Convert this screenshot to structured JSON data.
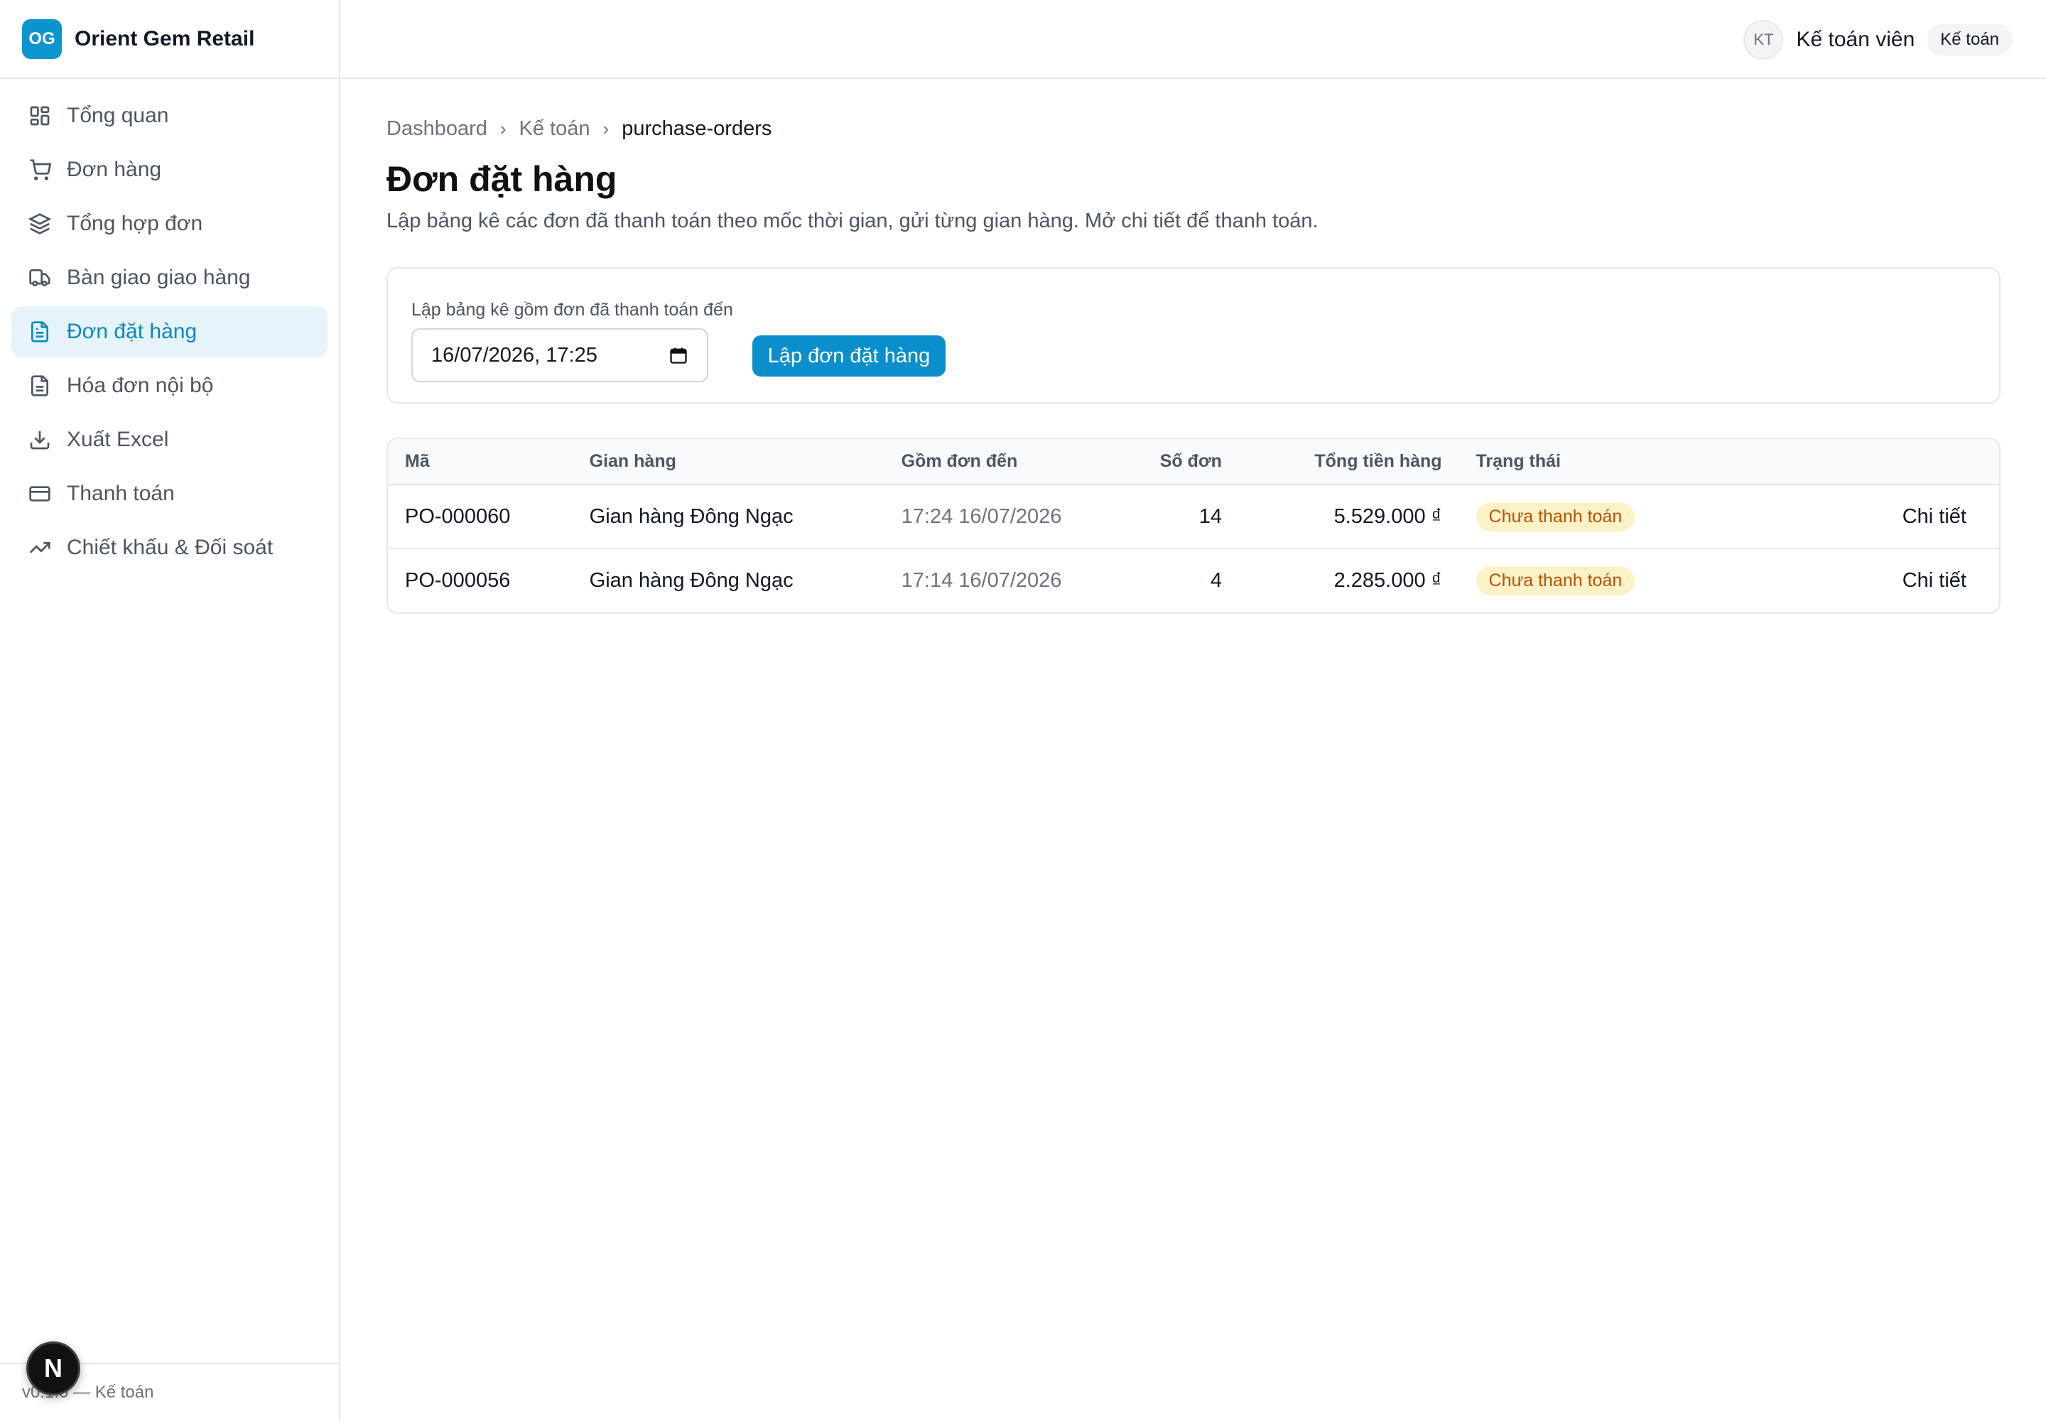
{
  "brand": {
    "logo": "OG",
    "name": "Orient Gem Retail"
  },
  "sidebar": {
    "items": [
      {
        "label": "Tổng quan",
        "icon": "dashboard-icon"
      },
      {
        "label": "Đơn hàng",
        "icon": "cart-icon"
      },
      {
        "label": "Tổng hợp đơn",
        "icon": "layers-icon"
      },
      {
        "label": "Bàn giao giao hàng",
        "icon": "truck-icon"
      },
      {
        "label": "Đơn đặt hàng",
        "icon": "document-icon",
        "active": true
      },
      {
        "label": "Hóa đơn nội bộ",
        "icon": "invoice-icon"
      },
      {
        "label": "Xuất Excel",
        "icon": "download-icon"
      },
      {
        "label": "Thanh toán",
        "icon": "credit-card-icon"
      },
      {
        "label": "Chiết khấu & Đối soát",
        "icon": "trending-up-icon"
      }
    ],
    "footer": "v0.1.0 — Kế toán",
    "next_badge": "N"
  },
  "topbar": {
    "avatar_initials": "KT",
    "user_name": "Kế toán viên",
    "role_badge": "Kế toán"
  },
  "breadcrumb": {
    "items": [
      "Dashboard",
      "Kế toán",
      "purchase-orders"
    ]
  },
  "page": {
    "title": "Đơn đặt hàng",
    "description": "Lập bảng kê các đơn đã thanh toán theo mốc thời gian, gửi từng gian hàng. Mở chi tiết để thanh toán."
  },
  "form": {
    "label": "Lập bảng kê gồm đơn đã thanh toán đến",
    "date_value": "16/07/2026, 17:25",
    "submit_label": "Lập đơn đặt hàng"
  },
  "table": {
    "headers": [
      "Mã",
      "Gian hàng",
      "Gồm đơn đến",
      "Số đơn",
      "Tổng tiền hàng",
      "Trạng thái",
      ""
    ],
    "rows": [
      {
        "code": "PO-000060",
        "store": "Gian hàng Đông Ngạc",
        "until": "17:24 16/07/2026",
        "count": "14",
        "total": "5.529.000 ₫",
        "status": "Chưa thanh toán",
        "action": "Chi tiết"
      },
      {
        "code": "PO-000056",
        "store": "Gian hàng Đông Ngạc",
        "until": "17:14 16/07/2026",
        "count": "4",
        "total": "2.285.000 ₫",
        "status": "Chưa thanh toán",
        "action": "Chi tiết"
      }
    ]
  },
  "colors": {
    "accent": "#0b8fcc",
    "active_bg": "#e5f3fa",
    "status_bg": "#fdf2c7",
    "status_text": "#b45309"
  }
}
